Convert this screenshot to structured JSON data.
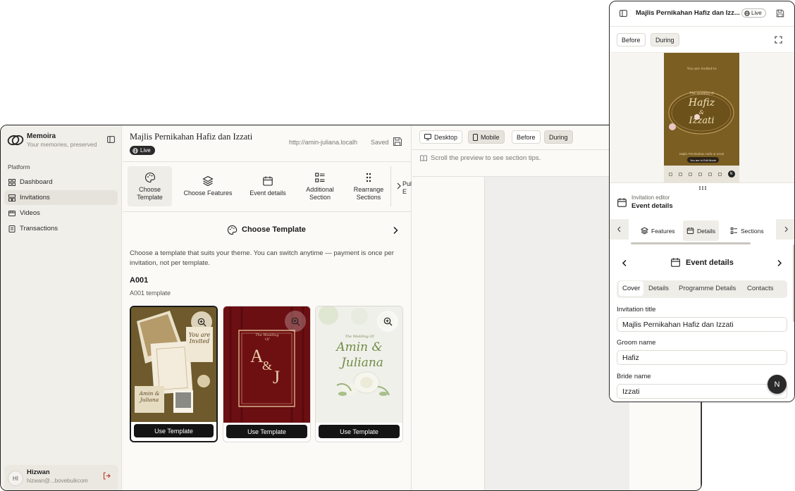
{
  "sidebar": {
    "brand_name": "Memoira",
    "brand_tagline": "Your memories, preserved",
    "section_label": "Platform",
    "items": [
      {
        "label": "Dashboard",
        "icon": "grid-icon"
      },
      {
        "label": "Invitations",
        "icon": "layout-icon",
        "active": true
      },
      {
        "label": "Videos",
        "icon": "film-icon"
      },
      {
        "label": "Transactions",
        "icon": "receipt-icon"
      }
    ],
    "user": {
      "initials": "HI",
      "name": "Hizwan",
      "email": "hizwan@...bovebuikcom"
    }
  },
  "editor": {
    "title": "Majlis Pernikahan Hafiz dan Izzati",
    "live_label": "Live",
    "url": "http://amin-juliana.localh",
    "saved_label": "Saved",
    "steps": [
      {
        "label": "Choose Template",
        "icon": "palette-icon",
        "active": true
      },
      {
        "label": "Choose Features",
        "icon": "layers-icon"
      },
      {
        "label": "Event details",
        "icon": "calendar-icon"
      },
      {
        "label": "Additional Section",
        "icon": "list-icon"
      },
      {
        "label": "Rearrange Sections",
        "icon": "grip-icon"
      },
      {
        "label": "Pul E",
        "icon": ""
      }
    ],
    "panel_title": "Choose Template",
    "panel_desc": "Choose a template that suits your theme. You can switch anytime — payment is once per invitation, not per template.",
    "group_code": "A001",
    "group_sub": "A001 template",
    "templates": [
      {
        "use_label": "Use Template",
        "script_top": "You are Invited",
        "script_names": "Amin & Juliana"
      },
      {
        "use_label": "Use Template",
        "small": "The Wedding Of",
        "initials_a": "A",
        "initials_amp": "&",
        "initials_b": "J"
      },
      {
        "use_label": "Use Template",
        "small": "The Wedding Of",
        "script_a": "Amin &",
        "script_b": "Juliana"
      }
    ]
  },
  "preview": {
    "buttons": [
      "Desktop",
      "Mobile",
      "Before",
      "During"
    ],
    "hint": "Scroll the preview to see section tips."
  },
  "mobile": {
    "title": "Majlis Pernikahan Hafiz dan Izz...",
    "live_label": "Live",
    "buttons": [
      "Before",
      "During"
    ],
    "card": {
      "invited": "You are invited to",
      "wedding_of": "The wedding of",
      "name_a": "Hafiz",
      "amp": "&",
      "name_b": "Izzati",
      "footer": "Majlis Pernikahan Hafiz & Izzati",
      "edit_mode": "You are in Edit Mode",
      "avatar": "N"
    },
    "editor_caption": "Invitation editor",
    "editor_section": "Event details",
    "tabs": [
      {
        "label": "Features",
        "icon": "layers-icon"
      },
      {
        "label": "Details",
        "icon": "calendar-icon",
        "active": true
      },
      {
        "label": "Sections",
        "icon": "list-icon"
      }
    ],
    "panel_title": "Event details",
    "segments": [
      {
        "label": "Cover",
        "active": true
      },
      {
        "label": "Details"
      },
      {
        "label": "Programme Details"
      },
      {
        "label": "Contacts"
      }
    ],
    "fields": [
      {
        "label": "Invitation title",
        "value": "Majlis Pernikahan Hafiz dan Izzati"
      },
      {
        "label": "Groom name",
        "value": "Hafiz"
      },
      {
        "label": "Bride name",
        "value": "Izzati"
      }
    ],
    "fab_initial": "N"
  },
  "colors": {
    "accent_dark": "#141414",
    "sidebar_bg": "#f1efea",
    "active_bg": "#e6e3dc",
    "gold": "#8a6a2c",
    "maroon": "#6e0f12"
  }
}
